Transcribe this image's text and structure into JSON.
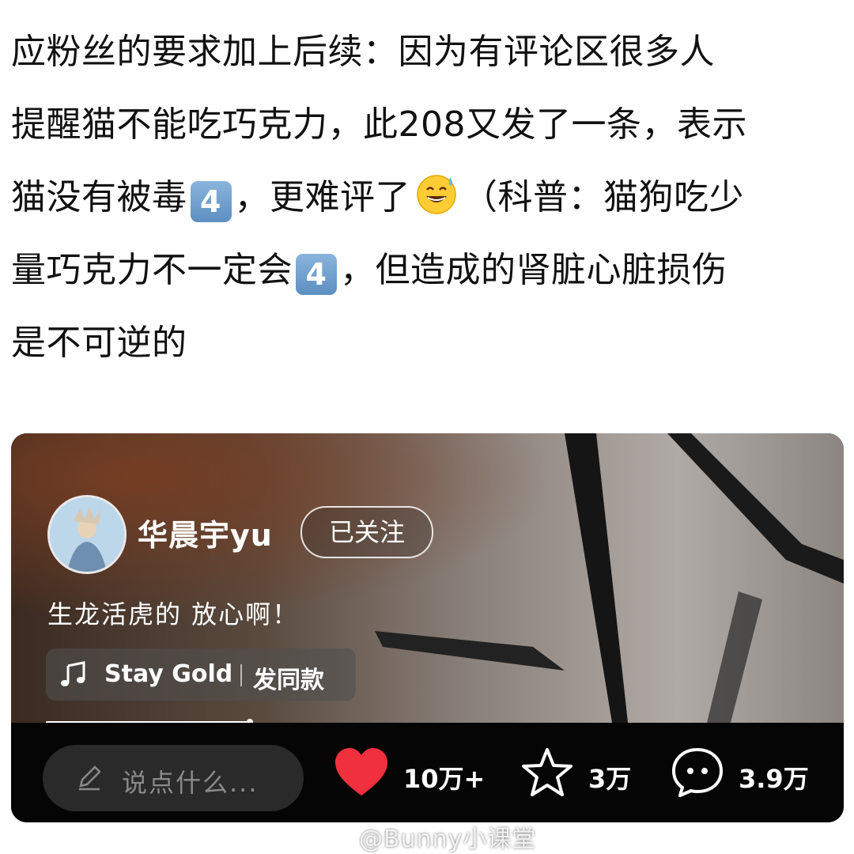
{
  "post": {
    "lines": [
      [
        "应粉丝的要求加上后续：因为有评论区很多人"
      ],
      [
        "提醒猫不能吃巧克力，此208又发了一条，表示"
      ],
      [
        "猫没有被毒",
        "{key}",
        "，更难评了",
        "{emoji}",
        "（科普：猫狗吃少"
      ],
      [
        "量巧克力不一定会",
        "{key}",
        "，但造成的肾脏心脏损伤"
      ],
      [
        "是不可逆的"
      ]
    ],
    "line1": "应粉丝的要求加上后续：因为有评论区很多人",
    "line2": "提醒猫不能吃巧克力，此208又发了一条，表示",
    "line3_a": "猫没有被毒",
    "line3_b": "，更难评了",
    "line3_c": "（科普：猫狗吃少",
    "line4_a": "量巧克力不一定会",
    "line4_b": "，但造成的肾脏心脏损伤",
    "line5": "是不可逆的",
    "keycap_digit": "4",
    "emoji": "grinning-sweat-emoji"
  },
  "video": {
    "username": "华晨宇yu",
    "follow_label": "已关注",
    "caption": "生龙活虎的 放心啊！",
    "music_title": "Stay Gold",
    "music_action": "发同款",
    "progress": 0.26
  },
  "bottom_bar": {
    "comment_placeholder": "说点什么...",
    "likes": "10万+",
    "favorites": "3万",
    "comments": "3.9万",
    "like_color": "#f0303d"
  },
  "watermark": "@Bunny小课堂"
}
